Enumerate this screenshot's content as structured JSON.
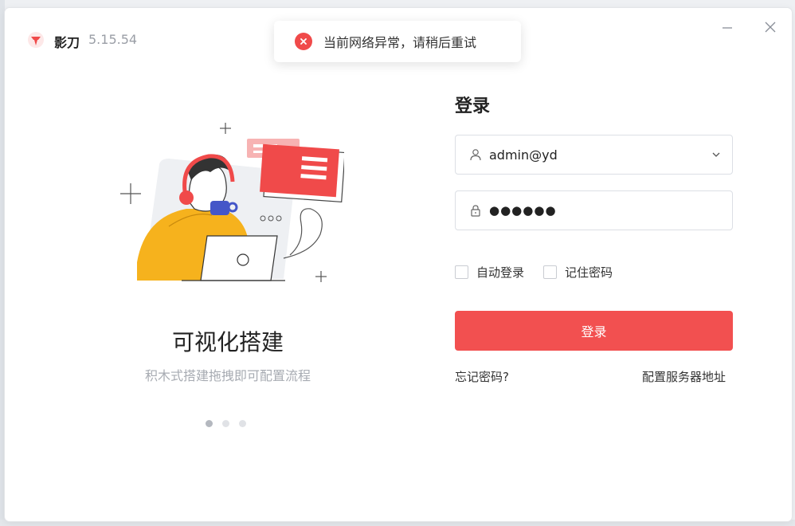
{
  "app": {
    "name": "影刀",
    "version": "5.15.54"
  },
  "toast": {
    "message": "当前网络异常，请稍后重试",
    "icon": "error-circle-icon",
    "color": "#f04a4a"
  },
  "carousel": {
    "title": "可视化搭建",
    "subtitle": "积木式搭建拖拽即可配置流程",
    "total_slides": 3,
    "active_slide": 1
  },
  "login": {
    "heading": "登录",
    "account": "admin@yd",
    "password_mask": "●●●●●●",
    "auto_login_label": "自动登录",
    "remember_password_label": "记住密码",
    "submit_label": "登录",
    "forgot_password": "忘记密码?",
    "configure_server": "配置服务器地址"
  },
  "colors": {
    "accent": "#f25050"
  }
}
